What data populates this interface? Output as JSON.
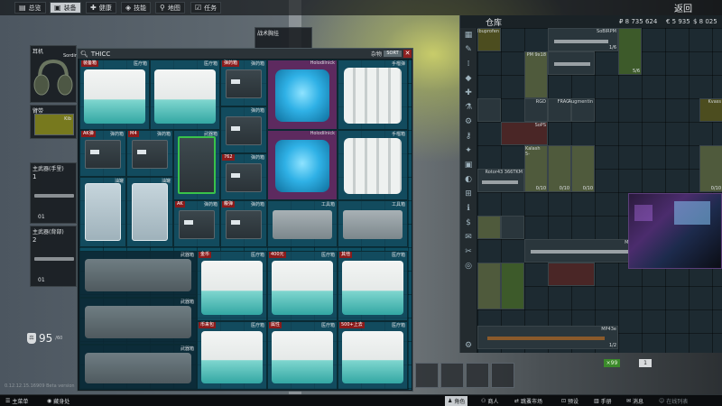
{
  "nav": {
    "tabs": [
      {
        "label": "总览",
        "icon": "overview-icon"
      },
      {
        "label": "装备",
        "icon": "gear-icon"
      },
      {
        "label": "健康",
        "icon": "health-icon"
      },
      {
        "label": "技能",
        "icon": "skills-icon"
      },
      {
        "label": "地图",
        "icon": "map-icon"
      },
      {
        "label": "任务",
        "icon": "tasks-icon"
      }
    ],
    "back_label": "返回"
  },
  "gear": {
    "headset_label": "耳机",
    "headset_item": "Sordin",
    "armband_label": "臂带",
    "armband_item": "Kib",
    "primary1_label": "主武器(手里)",
    "primary1_level": "1",
    "primary1_rank": "01",
    "primary2_label": "主武器(背部)",
    "primary2_level": "2",
    "primary2_rank": "01",
    "encumbrance_value": "95",
    "encumbrance_unit": "/60",
    "partial_label": "战术胸挂"
  },
  "container": {
    "title": "THICC",
    "weight_label": "杂物",
    "sort_label": "SORT",
    "close_label": "✕",
    "cells": [
      {
        "tag": "装备箱",
        "name": "医疗箱"
      },
      {
        "tag": "",
        "name": "医疗箱"
      },
      {
        "tag": "弹药箱",
        "name": "弹药箱"
      },
      {
        "tag": "",
        "name": "Holodilnick"
      },
      {
        "tag": "",
        "name": "手榴弹"
      },
      {
        "tag": "",
        "name": "弹药箱"
      },
      {
        "tag": "AK弹",
        "name": "弹药箱"
      },
      {
        "tag": "M4",
        "name": "弹药箱"
      },
      {
        "tag": "",
        "name": "武器箱"
      },
      {
        "tag": "762",
        "name": "弹药箱"
      },
      {
        "tag": "",
        "name": "Holodilnick"
      },
      {
        "tag": "",
        "name": "手榴箱"
      },
      {
        "tag": "",
        "name": "油罐"
      },
      {
        "tag": "",
        "name": "油罐"
      },
      {
        "tag": "AK",
        "name": "弹药箱"
      },
      {
        "tag": "霰弹",
        "name": "弹药箱"
      },
      {
        "tag": "",
        "name": "工具箱"
      },
      {
        "tag": "",
        "name": "工具箱"
      },
      {
        "tag": "",
        "name": "武器箱"
      },
      {
        "tag": "金币",
        "name": "医疗箱"
      },
      {
        "tag": "400元",
        "name": "医疗箱"
      },
      {
        "tag": "其他",
        "name": "医疗箱"
      },
      {
        "tag": "",
        "name": "武器箱"
      },
      {
        "tag": "",
        "name": "武器箱"
      },
      {
        "tag": "币来包",
        "name": "医疗箱"
      },
      {
        "tag": "属性",
        "name": "医疗箱"
      },
      {
        "tag": "500+上去",
        "name": "医疗箱"
      }
    ]
  },
  "stash": {
    "title": "仓库",
    "roubles": "₽ 8 735 624",
    "euros": "€ 5 935",
    "dollars": "$ 8 025",
    "items": [
      {
        "name": "Ibuprofen",
        "count": ""
      },
      {
        "name": "SoBIRPM",
        "count": "1/6"
      },
      {
        "name": "",
        "count": "5/6"
      },
      {
        "name": "PM 9x18",
        "count": ""
      },
      {
        "name": "RGD",
        "count": ""
      },
      {
        "name": "FRAG",
        "count": ""
      },
      {
        "name": "Augmentin",
        "count": ""
      },
      {
        "name": "Kvass",
        "count": ""
      },
      {
        "name": "SoPS",
        "count": ""
      },
      {
        "name": "Kalash 5-",
        "count": ""
      },
      {
        "name": "",
        "count": "0/10"
      },
      {
        "name": "",
        "count": "0/10"
      },
      {
        "name": "",
        "count": "0/10"
      },
      {
        "name": "Rotor43 366TKM",
        "count": ""
      },
      {
        "name": "",
        "count": "0/10"
      },
      {
        "name": "MP153",
        "count": ""
      },
      {
        "name": "MP43e",
        "count": "1/2"
      }
    ],
    "money_badge": "×99",
    "tiny_badge": "1"
  },
  "build": "0.12.12.15.16909 Beta version",
  "bottombar": {
    "menu_label": "主菜单",
    "hideout_label": "藏身处",
    "character_label": "角色",
    "traders_label": "商人",
    "flea_label": "跳蚤市场",
    "preset_label": "预设",
    "handbook_label": "手册",
    "messages_label": "消息",
    "online_label": "在线列表"
  },
  "colors": {
    "container_bg": "#0e4f63",
    "highlight_purple": "#5d2a5f",
    "tag_red": "#8a1b1b",
    "stash_bg": "#1d2a31",
    "accent_green": "#39c24a"
  }
}
